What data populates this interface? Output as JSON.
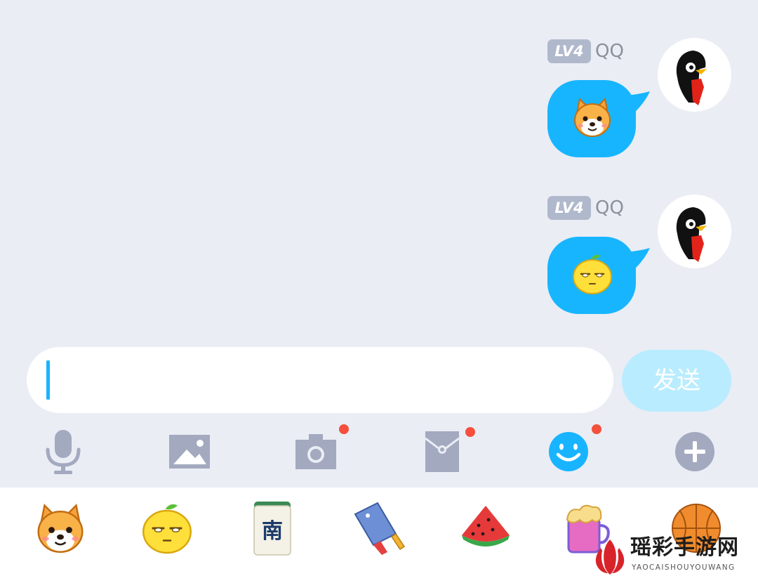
{
  "messages": [
    {
      "level": "LV4",
      "sender": "QQ",
      "avatar_icon": "qq-penguin-icon",
      "sticker_icon": "shiba-dog-icon",
      "bubble_color": "#18b5ff"
    },
    {
      "level": "LV4",
      "sender": "QQ",
      "avatar_icon": "qq-penguin-icon",
      "sticker_icon": "lemon-face-icon",
      "bubble_color": "#18b5ff"
    }
  ],
  "input": {
    "value": "",
    "placeholder": ""
  },
  "send_button": {
    "label": "发送",
    "enabled": false
  },
  "toolbar": [
    {
      "icon": "microphone-icon",
      "badge": false
    },
    {
      "icon": "image-icon",
      "badge": false
    },
    {
      "icon": "camera-icon",
      "badge": true
    },
    {
      "icon": "red-packet-icon",
      "badge": true
    },
    {
      "icon": "emoji-icon",
      "badge": true,
      "active": true
    },
    {
      "icon": "plus-icon",
      "badge": false
    }
  ],
  "stickers": [
    "shiba-dog-icon",
    "lemon-face-icon",
    "mahjong-south-tile-icon",
    "cleaver-knife-icon",
    "watermelon-slice-icon",
    "beer-mug-icon",
    "basketball-icon"
  ],
  "watermark": {
    "title": "瑶彩手游网",
    "subtitle": "YAOCAISHOUYOUWANG"
  },
  "colors": {
    "background": "#eaedf4",
    "accent": "#19b4ff",
    "send_disabled": "#b9ecff",
    "icon_gray": "#a3a9bf",
    "badge_red": "#f5503c"
  }
}
